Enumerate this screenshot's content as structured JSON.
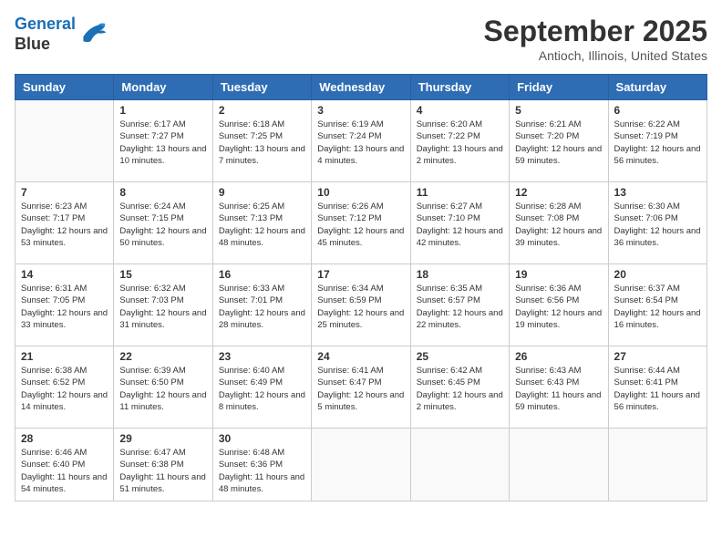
{
  "header": {
    "logo_line1": "General",
    "logo_line2": "Blue",
    "title": "September 2025",
    "subtitle": "Antioch, Illinois, United States"
  },
  "weekdays": [
    "Sunday",
    "Monday",
    "Tuesday",
    "Wednesday",
    "Thursday",
    "Friday",
    "Saturday"
  ],
  "weeks": [
    [
      {
        "day": "",
        "empty": true
      },
      {
        "day": "1",
        "sunrise": "6:17 AM",
        "sunset": "7:27 PM",
        "daylight": "13 hours and 10 minutes."
      },
      {
        "day": "2",
        "sunrise": "6:18 AM",
        "sunset": "7:25 PM",
        "daylight": "13 hours and 7 minutes."
      },
      {
        "day": "3",
        "sunrise": "6:19 AM",
        "sunset": "7:24 PM",
        "daylight": "13 hours and 4 minutes."
      },
      {
        "day": "4",
        "sunrise": "6:20 AM",
        "sunset": "7:22 PM",
        "daylight": "13 hours and 2 minutes."
      },
      {
        "day": "5",
        "sunrise": "6:21 AM",
        "sunset": "7:20 PM",
        "daylight": "12 hours and 59 minutes."
      },
      {
        "day": "6",
        "sunrise": "6:22 AM",
        "sunset": "7:19 PM",
        "daylight": "12 hours and 56 minutes."
      }
    ],
    [
      {
        "day": "7",
        "sunrise": "6:23 AM",
        "sunset": "7:17 PM",
        "daylight": "12 hours and 53 minutes."
      },
      {
        "day": "8",
        "sunrise": "6:24 AM",
        "sunset": "7:15 PM",
        "daylight": "12 hours and 50 minutes."
      },
      {
        "day": "9",
        "sunrise": "6:25 AM",
        "sunset": "7:13 PM",
        "daylight": "12 hours and 48 minutes."
      },
      {
        "day": "10",
        "sunrise": "6:26 AM",
        "sunset": "7:12 PM",
        "daylight": "12 hours and 45 minutes."
      },
      {
        "day": "11",
        "sunrise": "6:27 AM",
        "sunset": "7:10 PM",
        "daylight": "12 hours and 42 minutes."
      },
      {
        "day": "12",
        "sunrise": "6:28 AM",
        "sunset": "7:08 PM",
        "daylight": "12 hours and 39 minutes."
      },
      {
        "day": "13",
        "sunrise": "6:30 AM",
        "sunset": "7:06 PM",
        "daylight": "12 hours and 36 minutes."
      }
    ],
    [
      {
        "day": "14",
        "sunrise": "6:31 AM",
        "sunset": "7:05 PM",
        "daylight": "12 hours and 33 minutes."
      },
      {
        "day": "15",
        "sunrise": "6:32 AM",
        "sunset": "7:03 PM",
        "daylight": "12 hours and 31 minutes."
      },
      {
        "day": "16",
        "sunrise": "6:33 AM",
        "sunset": "7:01 PM",
        "daylight": "12 hours and 28 minutes."
      },
      {
        "day": "17",
        "sunrise": "6:34 AM",
        "sunset": "6:59 PM",
        "daylight": "12 hours and 25 minutes."
      },
      {
        "day": "18",
        "sunrise": "6:35 AM",
        "sunset": "6:57 PM",
        "daylight": "12 hours and 22 minutes."
      },
      {
        "day": "19",
        "sunrise": "6:36 AM",
        "sunset": "6:56 PM",
        "daylight": "12 hours and 19 minutes."
      },
      {
        "day": "20",
        "sunrise": "6:37 AM",
        "sunset": "6:54 PM",
        "daylight": "12 hours and 16 minutes."
      }
    ],
    [
      {
        "day": "21",
        "sunrise": "6:38 AM",
        "sunset": "6:52 PM",
        "daylight": "12 hours and 14 minutes."
      },
      {
        "day": "22",
        "sunrise": "6:39 AM",
        "sunset": "6:50 PM",
        "daylight": "12 hours and 11 minutes."
      },
      {
        "day": "23",
        "sunrise": "6:40 AM",
        "sunset": "6:49 PM",
        "daylight": "12 hours and 8 minutes."
      },
      {
        "day": "24",
        "sunrise": "6:41 AM",
        "sunset": "6:47 PM",
        "daylight": "12 hours and 5 minutes."
      },
      {
        "day": "25",
        "sunrise": "6:42 AM",
        "sunset": "6:45 PM",
        "daylight": "12 hours and 2 minutes."
      },
      {
        "day": "26",
        "sunrise": "6:43 AM",
        "sunset": "6:43 PM",
        "daylight": "11 hours and 59 minutes."
      },
      {
        "day": "27",
        "sunrise": "6:44 AM",
        "sunset": "6:41 PM",
        "daylight": "11 hours and 56 minutes."
      }
    ],
    [
      {
        "day": "28",
        "sunrise": "6:46 AM",
        "sunset": "6:40 PM",
        "daylight": "11 hours and 54 minutes."
      },
      {
        "day": "29",
        "sunrise": "6:47 AM",
        "sunset": "6:38 PM",
        "daylight": "11 hours and 51 minutes."
      },
      {
        "day": "30",
        "sunrise": "6:48 AM",
        "sunset": "6:36 PM",
        "daylight": "11 hours and 48 minutes."
      },
      {
        "day": "",
        "empty": true
      },
      {
        "day": "",
        "empty": true
      },
      {
        "day": "",
        "empty": true
      },
      {
        "day": "",
        "empty": true
      }
    ]
  ],
  "labels": {
    "sunrise": "Sunrise:",
    "sunset": "Sunset:",
    "daylight": "Daylight:"
  }
}
